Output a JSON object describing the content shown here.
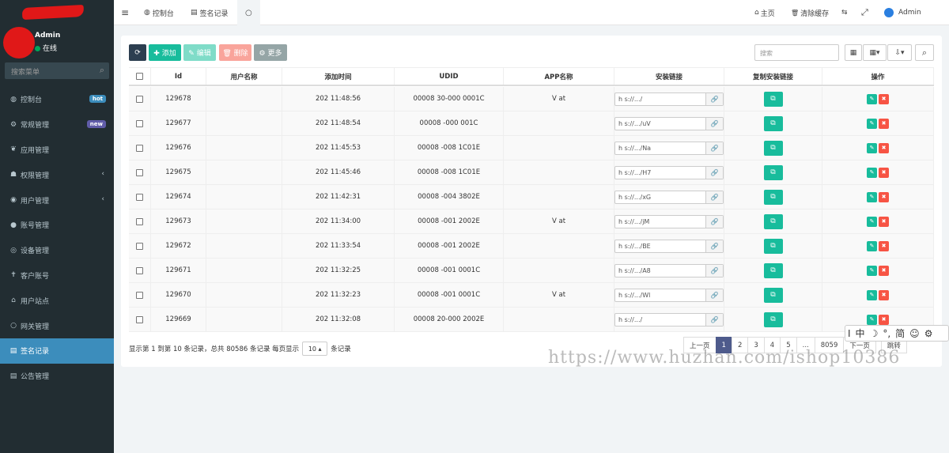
{
  "sidebar": {
    "user_name": "Admin",
    "status": "在线",
    "search_placeholder": "搜索菜单",
    "items": [
      {
        "label": "控制台",
        "icon": "dashboard-icon",
        "glyph": "◍",
        "badge": "hot"
      },
      {
        "label": "常规管理",
        "icon": "cogs-icon",
        "glyph": "⚙",
        "badge": "new"
      },
      {
        "label": "应用管理",
        "icon": "leaf-icon",
        "glyph": "❦"
      },
      {
        "label": "权限管理",
        "icon": "group-icon",
        "glyph": "☗",
        "caret": "‹"
      },
      {
        "label": "用户管理",
        "icon": "user-circle-icon",
        "glyph": "◉",
        "caret": "‹"
      },
      {
        "label": "账号管理",
        "icon": "apple-icon",
        "glyph": "●"
      },
      {
        "label": "设备管理",
        "icon": "device-icon",
        "glyph": "◎"
      },
      {
        "label": "客户账号",
        "icon": "pin-icon",
        "glyph": "✝"
      },
      {
        "label": "用户站点",
        "icon": "bank-icon",
        "glyph": "⌂"
      },
      {
        "label": "网关管理",
        "icon": "circle-icon",
        "glyph": "○"
      },
      {
        "label": "签名记录",
        "icon": "file-icon",
        "glyph": "▤",
        "active": true
      },
      {
        "label": "公告管理",
        "icon": "doc-icon",
        "glyph": "▤"
      }
    ]
  },
  "topbar": {
    "menu_glyph": "≡",
    "tabs": [
      {
        "label": "控制台",
        "glyph": "◍"
      },
      {
        "label": "签名记录",
        "glyph": "▤"
      }
    ],
    "refresh_glyph": "○",
    "right": {
      "home": "主页",
      "home_glyph": "⌂",
      "clear_cache": "清除缓存",
      "clear_glyph": "🗑",
      "lang_glyph": "⇆",
      "fullscreen_glyph": "⤢",
      "admin": "Admin"
    }
  },
  "toolbar": {
    "refresh_glyph": "⟳",
    "add": "✚ 添加",
    "edit": "✎ 编辑",
    "delete": "🗑 删除",
    "more": "⚙ 更多",
    "search_placeholder": "搜索",
    "columns_glyph": "▦",
    "grid_glyph": "▦▾",
    "export_glyph": "⇩▾",
    "search_glyph": "⌕"
  },
  "table": {
    "headers": [
      "Id",
      "用户名称",
      "添加时间",
      "UDID",
      "APP名称",
      "安装链接",
      "复制安装链接",
      "操作"
    ],
    "rows": [
      {
        "id": "129678",
        "user": "",
        "time": "202   11:48:56",
        "udid": "00008  30-000  0001C",
        "app": "V   at",
        "link": "h  s://.../"
      },
      {
        "id": "129677",
        "user": "",
        "time": "202   11:48:54",
        "udid": "00008  -000   001C",
        "app": "",
        "link": "h  s://.../uV"
      },
      {
        "id": "129676",
        "user": "",
        "time": "202   11:45:53",
        "udid": "00008  -008  1C01E",
        "app": "",
        "link": "h  s://.../Na"
      },
      {
        "id": "129675",
        "user": "",
        "time": "202   11:45:46",
        "udid": "00008  -008  1C01E",
        "app": "",
        "link": "h  s://.../H7"
      },
      {
        "id": "129674",
        "user": "",
        "time": "202   11:42:31",
        "udid": "00008  -004  3802E",
        "app": "",
        "link": "h  s://.../xG"
      },
      {
        "id": "129673",
        "user": "",
        "time": "202   11:34:00",
        "udid": "00008  -001  2002E",
        "app": "V   at",
        "link": "h  s://.../jM"
      },
      {
        "id": "129672",
        "user": "",
        "time": "202   11:33:54",
        "udid": "00008  -001  2002E",
        "app": "",
        "link": "h  s://.../BE"
      },
      {
        "id": "129671",
        "user": "",
        "time": "202   11:32:25",
        "udid": "00008  -001  0001C",
        "app": "",
        "link": "h  s://.../A8"
      },
      {
        "id": "129670",
        "user": "",
        "time": "202   11:32:23",
        "udid": "00008  -001  0001C",
        "app": "V   at",
        "link": "h  s://.../Wl"
      },
      {
        "id": "129669",
        "user": "",
        "time": "202   11:32:08",
        "udid": "00008  20-000  2002E",
        "app": "",
        "link": "h  s://.../"
      }
    ]
  },
  "footer": {
    "info_prefix": "显示第 1 到第 10 条记录，总共 80586 条记录 每页显示",
    "page_size": "10 ▴",
    "info_suffix": "条记录",
    "pages": [
      "上一页",
      "1",
      "2",
      "3",
      "4",
      "5",
      "...",
      "8059",
      "下一页",
      "跳转"
    ]
  },
  "overlay": {
    "ime": [
      "I",
      "中",
      "☽",
      "°,",
      "简",
      "☺",
      "⚙"
    ],
    "watermark": "https://www.huzhan.com/ishop10386"
  },
  "colors": {
    "sidebar_bg": "#222d32",
    "active": "#3c8dbc",
    "add": "#18bc9c",
    "delete": "#f75444",
    "more": "#95a5a6",
    "refresh": "#2c3e50"
  }
}
